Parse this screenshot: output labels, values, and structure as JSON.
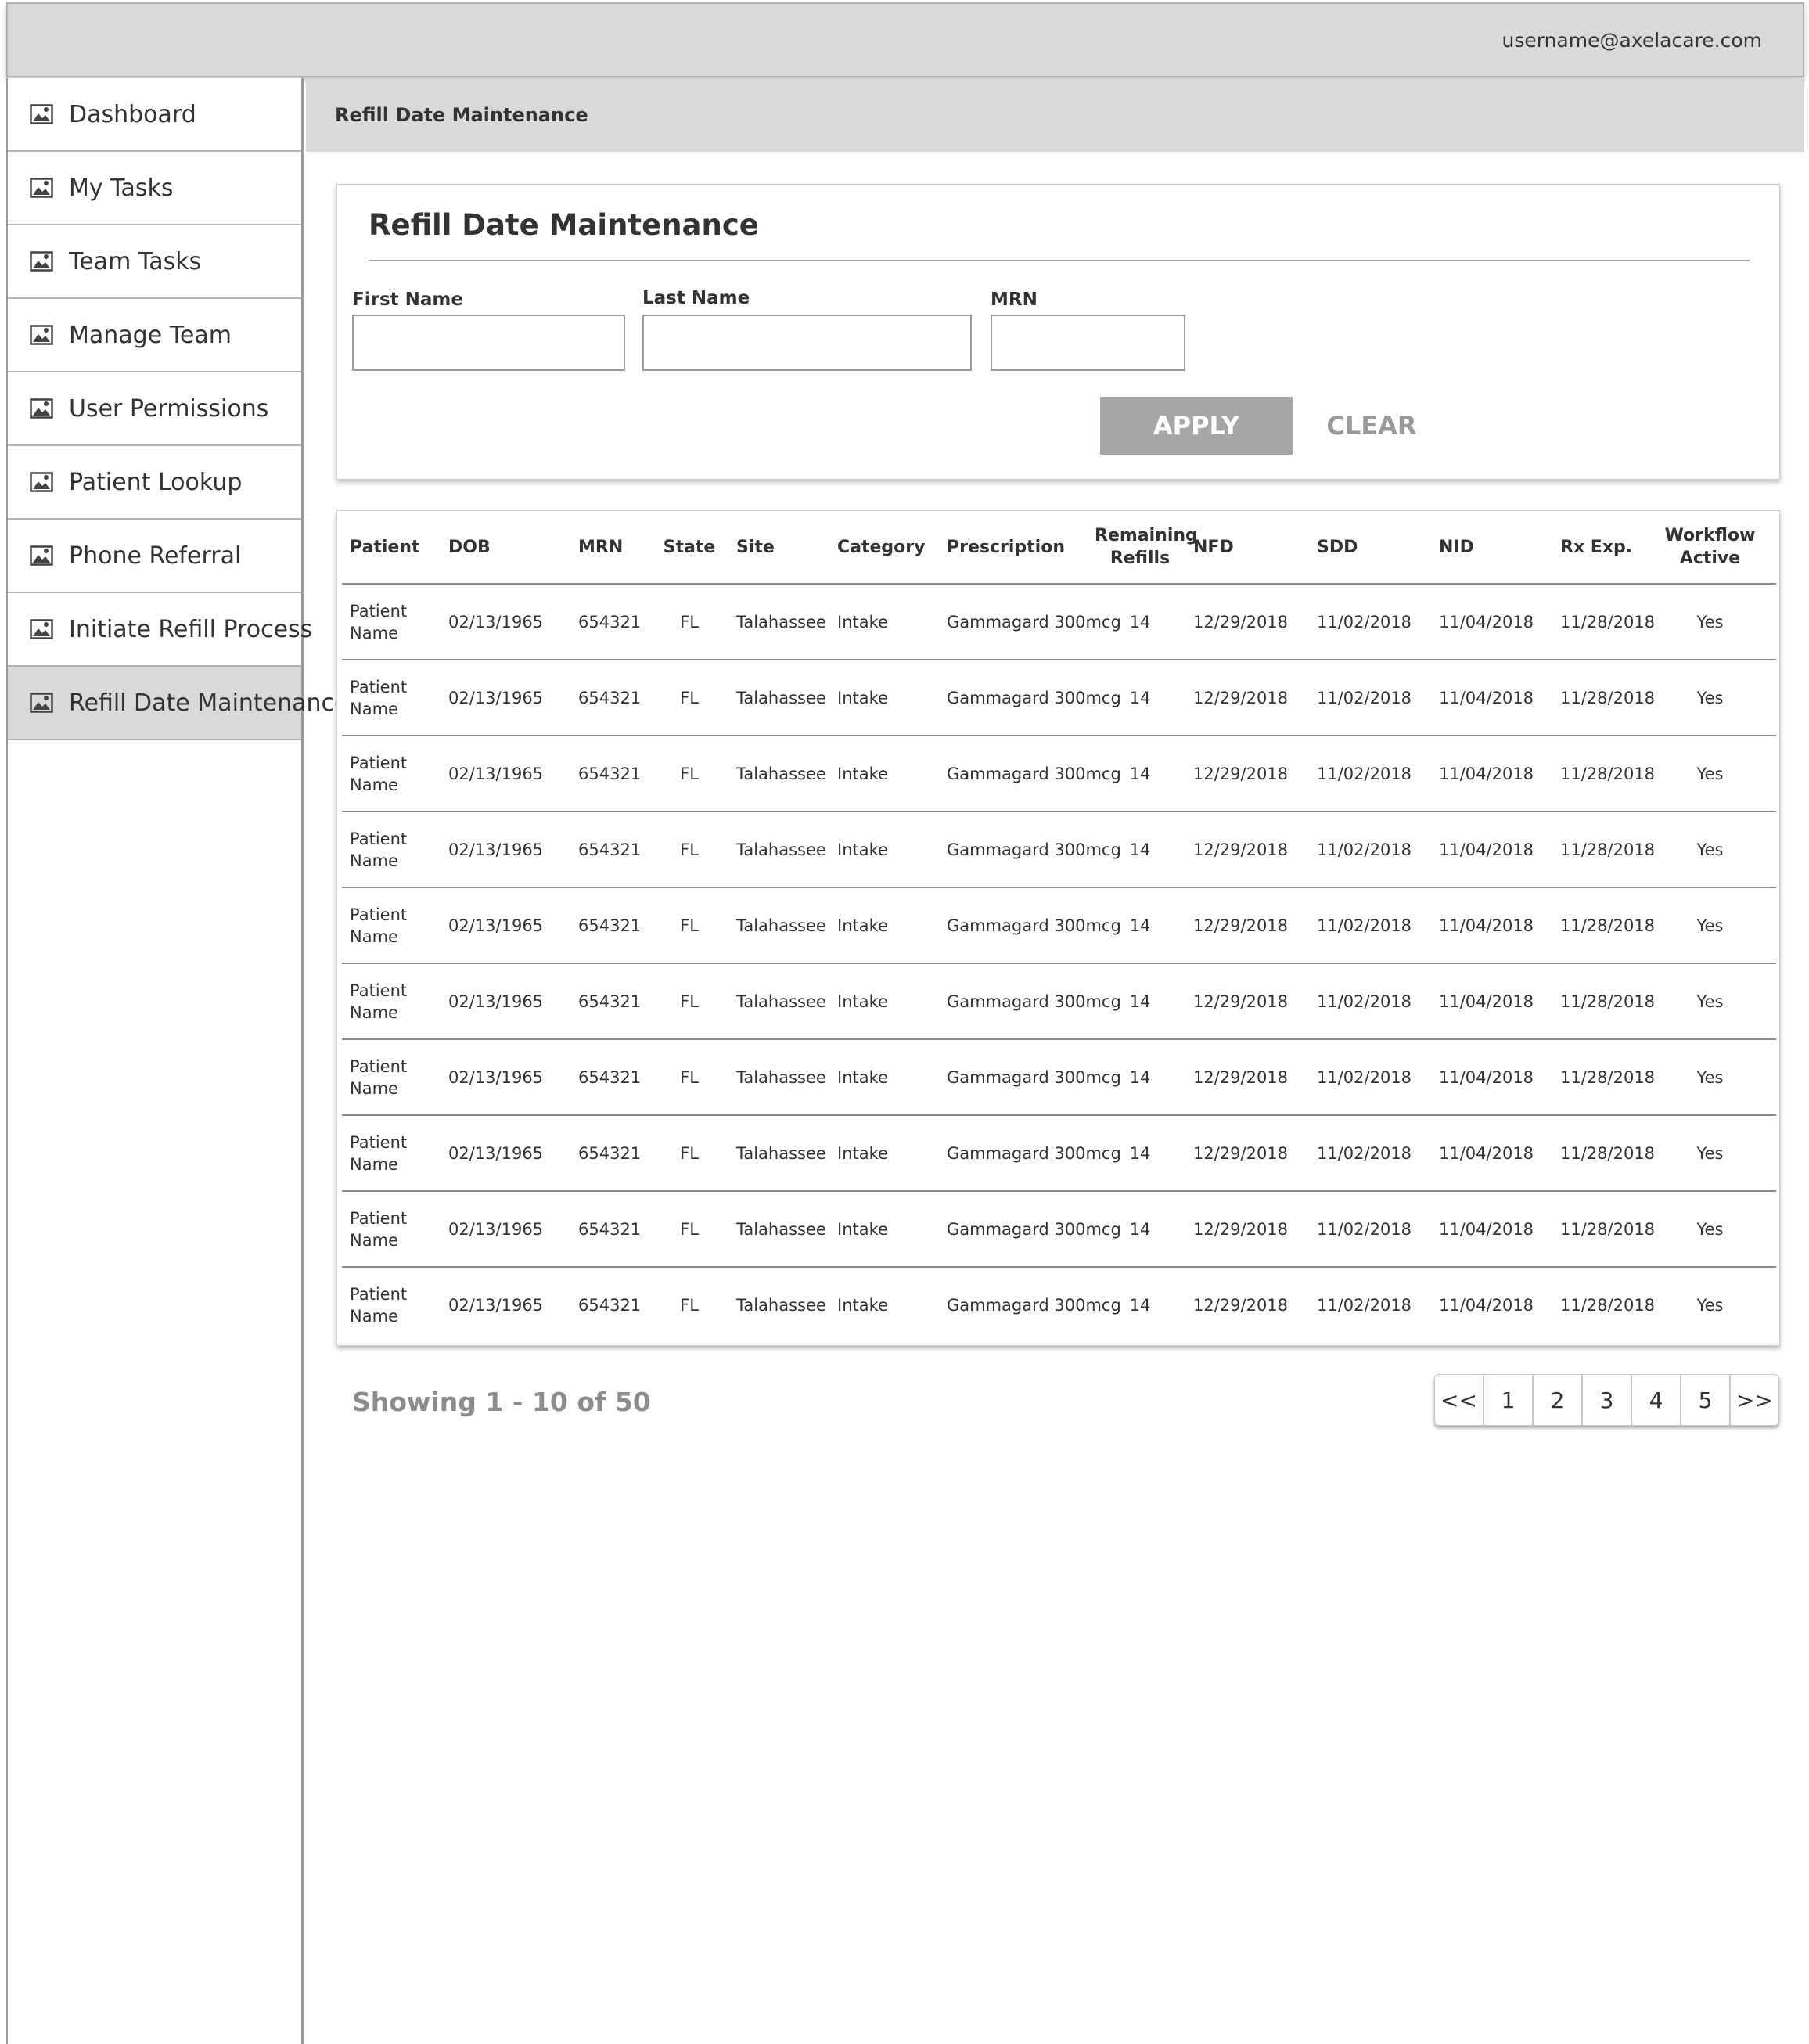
{
  "header": {
    "user_email": "username@axelacare.com"
  },
  "sidebar": {
    "items": [
      {
        "label": "Dashboard",
        "icon": "image-icon"
      },
      {
        "label": "My Tasks",
        "icon": "image-icon"
      },
      {
        "label": "Team Tasks",
        "icon": "image-icon"
      },
      {
        "label": "Manage Team",
        "icon": "image-icon"
      },
      {
        "label": "User Permissions",
        "icon": "image-icon"
      },
      {
        "label": "Patient Lookup",
        "icon": "image-icon"
      },
      {
        "label": "Phone Referral",
        "icon": "image-icon"
      },
      {
        "label": "Initiate Refill Process",
        "icon": "image-icon"
      },
      {
        "label": "Refill Date Maintenance",
        "icon": "image-icon",
        "active": true
      }
    ]
  },
  "breadcrumb": "Refill Date Maintenance",
  "filter": {
    "title": "Refill Date Maintenance",
    "first_name_label": "First Name",
    "first_name_value": "",
    "last_name_label": "Last Name",
    "last_name_value": "",
    "mrn_label": "MRN",
    "mrn_value": "",
    "apply_label": "APPLY",
    "clear_label": "CLEAR"
  },
  "table": {
    "columns": [
      "Patient",
      "DOB",
      "MRN",
      "State",
      "Site",
      "Category",
      "Prescription",
      "Remaining Refills",
      "NFD",
      "SDD",
      "NID",
      "Rx Exp.",
      "Workflow Active"
    ],
    "rows": [
      [
        "Patient Name",
        "02/13/1965",
        "654321",
        "FL",
        "Talahassee",
        "Intake",
        "Gammagard 300mcg",
        "14",
        "12/29/2018",
        "11/02/2018",
        "11/04/2018",
        "11/28/2018",
        "Yes"
      ],
      [
        "Patient Name",
        "02/13/1965",
        "654321",
        "FL",
        "Talahassee",
        "Intake",
        "Gammagard 300mcg",
        "14",
        "12/29/2018",
        "11/02/2018",
        "11/04/2018",
        "11/28/2018",
        "Yes"
      ],
      [
        "Patient Name",
        "02/13/1965",
        "654321",
        "FL",
        "Talahassee",
        "Intake",
        "Gammagard 300mcg",
        "14",
        "12/29/2018",
        "11/02/2018",
        "11/04/2018",
        "11/28/2018",
        "Yes"
      ],
      [
        "Patient Name",
        "02/13/1965",
        "654321",
        "FL",
        "Talahassee",
        "Intake",
        "Gammagard 300mcg",
        "14",
        "12/29/2018",
        "11/02/2018",
        "11/04/2018",
        "11/28/2018",
        "Yes"
      ],
      [
        "Patient Name",
        "02/13/1965",
        "654321",
        "FL",
        "Talahassee",
        "Intake",
        "Gammagard 300mcg",
        "14",
        "12/29/2018",
        "11/02/2018",
        "11/04/2018",
        "11/28/2018",
        "Yes"
      ],
      [
        "Patient Name",
        "02/13/1965",
        "654321",
        "FL",
        "Talahassee",
        "Intake",
        "Gammagard 300mcg",
        "14",
        "12/29/2018",
        "11/02/2018",
        "11/04/2018",
        "11/28/2018",
        "Yes"
      ],
      [
        "Patient Name",
        "02/13/1965",
        "654321",
        "FL",
        "Talahassee",
        "Intake",
        "Gammagard 300mcg",
        "14",
        "12/29/2018",
        "11/02/2018",
        "11/04/2018",
        "11/28/2018",
        "Yes"
      ],
      [
        "Patient Name",
        "02/13/1965",
        "654321",
        "FL",
        "Talahassee",
        "Intake",
        "Gammagard 300mcg",
        "14",
        "12/29/2018",
        "11/02/2018",
        "11/04/2018",
        "11/28/2018",
        "Yes"
      ],
      [
        "Patient Name",
        "02/13/1965",
        "654321",
        "FL",
        "Talahassee",
        "Intake",
        "Gammagard 300mcg",
        "14",
        "12/29/2018",
        "11/02/2018",
        "11/04/2018",
        "11/28/2018",
        "Yes"
      ],
      [
        "Patient Name",
        "02/13/1965",
        "654321",
        "FL",
        "Talahassee",
        "Intake",
        "Gammagard 300mcg",
        "14",
        "12/29/2018",
        "11/02/2018",
        "11/04/2018",
        "11/28/2018",
        "Yes"
      ]
    ]
  },
  "pagination": {
    "showing_text": "Showing 1 - 10 of 50",
    "first_label": "<<",
    "pages": [
      "1",
      "2",
      "3",
      "4",
      "5"
    ],
    "last_label": ">>"
  },
  "colors": {
    "header_bg": "#d9d9d9",
    "active_nav_bg": "#d9d9d9",
    "apply_bg": "#a6a6a6",
    "muted_text": "#8c8c8c"
  }
}
